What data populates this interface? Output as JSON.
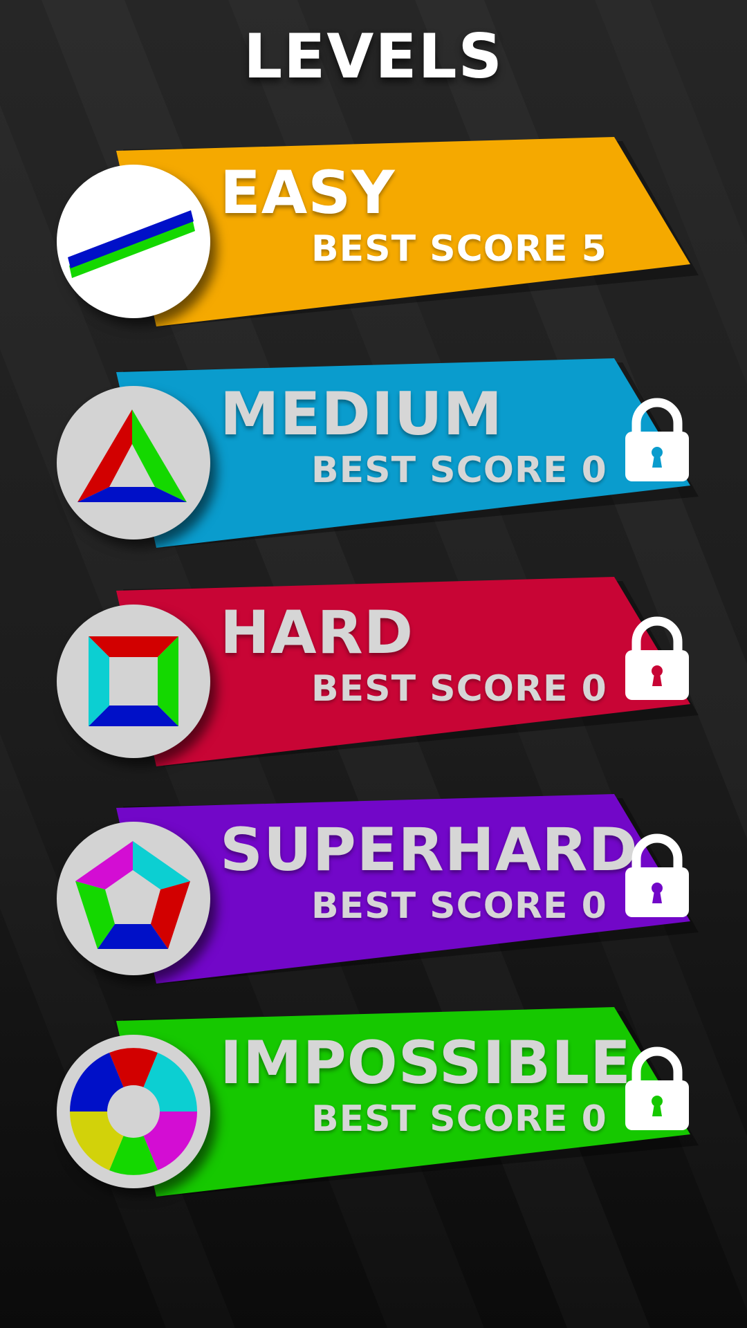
{
  "screen": {
    "title": "LEVELS"
  },
  "levels": [
    {
      "name": "EASY",
      "best_score_label": "BEST SCORE 5",
      "color": "#f5a900",
      "text_color": "#ffffff",
      "locked": false,
      "icon": "line-icon"
    },
    {
      "name": "MEDIUM",
      "best_score_label": "BEST SCORE 0",
      "color": "#0a9ccd",
      "text_color": "#d6d6d6",
      "locked": true,
      "icon": "triangle-icon"
    },
    {
      "name": "HARD",
      "best_score_label": "BEST SCORE 0",
      "color": "#c80535",
      "text_color": "#d6d6d6",
      "locked": true,
      "icon": "square-icon"
    },
    {
      "name": "SUPERHARD",
      "best_score_label": "BEST SCORE 0",
      "color": "#7207c8",
      "text_color": "#d6d6d6",
      "locked": true,
      "icon": "pentagon-icon"
    },
    {
      "name": "IMPOSSIBLE",
      "best_score_label": "BEST SCORE 0",
      "color": "#16c800",
      "text_color": "#d6d6d6",
      "locked": true,
      "icon": "hexagon-ring-icon"
    }
  ],
  "palette": {
    "red": "#d20000",
    "green": "#14d800",
    "blue": "#0010c8",
    "cyan": "#0ccfd2",
    "magenta": "#d30dd3",
    "yellow": "#d2d20a",
    "circle_locked": "#d3d3d3",
    "circle_unlocked": "#ffffff"
  }
}
